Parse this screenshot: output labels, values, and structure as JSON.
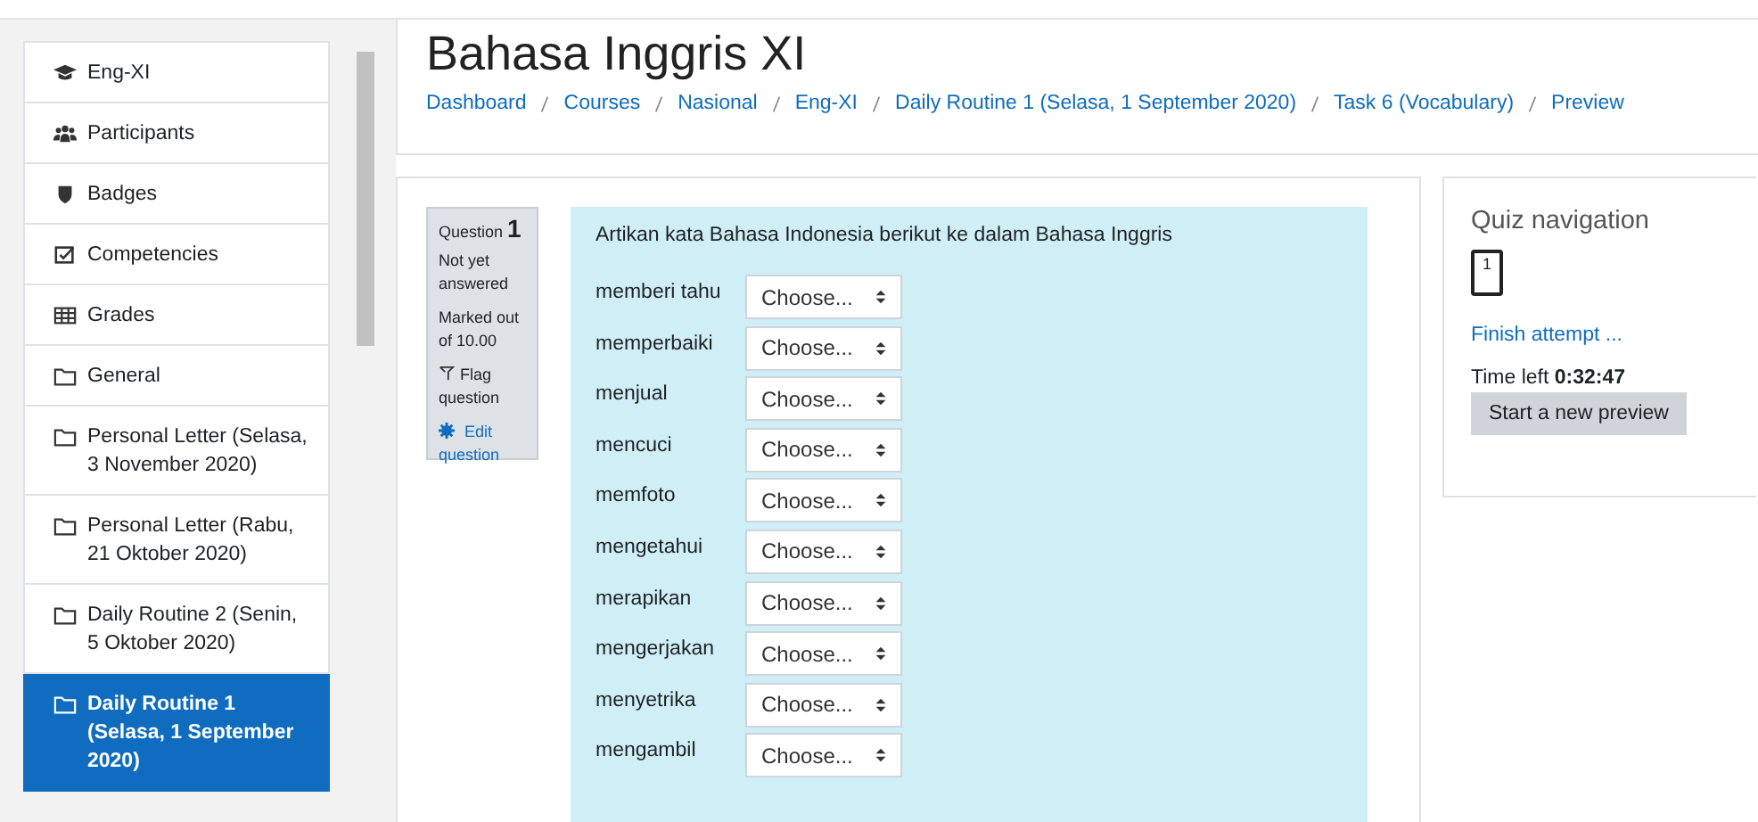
{
  "sidebar": {
    "items": [
      {
        "label": "Eng-XI",
        "kind": "cap",
        "selected": false
      },
      {
        "label": "Participants",
        "kind": "people",
        "selected": false
      },
      {
        "label": "Badges",
        "kind": "shield",
        "selected": false
      },
      {
        "label": "Competencies",
        "kind": "checkbox",
        "selected": false
      },
      {
        "label": "Grades",
        "kind": "grid",
        "selected": false
      },
      {
        "label": "General",
        "kind": "folder",
        "selected": false
      },
      {
        "label": "Personal Letter (Selasa, 3 November 2020)",
        "kind": "folder",
        "selected": false
      },
      {
        "label": "Personal Letter (Rabu, 21 Oktober 2020)",
        "kind": "folder",
        "selected": false
      },
      {
        "label": "Daily Routine 2 (Senin, 5 Oktober 2020)",
        "kind": "folder",
        "selected": false
      },
      {
        "label": "Daily Routine 1 (Selasa, 1 September 2020)",
        "kind": "folder",
        "selected": true
      }
    ]
  },
  "page_title": "Bahasa Inggris XI",
  "breadcrumbs": [
    "Dashboard",
    "Courses",
    "Nasional",
    "Eng-XI",
    "Daily Routine 1 (Selasa, 1 September 2020)",
    "Task 6 (Vocabulary)",
    "Preview"
  ],
  "question_info": {
    "number": "Question **1**",
    "status": "Not yet answered",
    "marks": "Marked out of 10.00",
    "flag": "Flag question",
    "edit": "Edit question"
  },
  "question": {
    "prompt": "Artikan kata Bahasa Indonesia berikut ke dalam Bahasa Inggris",
    "rows": [
      {
        "word": "memberi tahu",
        "value": "Choose..."
      },
      {
        "word": "memperbaiki",
        "value": "Choose..."
      },
      {
        "word": "menjual",
        "value": "Choose..."
      },
      {
        "word": "mencuci",
        "value": "Choose..."
      },
      {
        "word": "memfoto",
        "value": "Choose..."
      },
      {
        "word": "mengetahui",
        "value": "Choose..."
      },
      {
        "word": "merapikan",
        "value": "Choose..."
      },
      {
        "word": "mengerjakan",
        "value": "Choose..."
      },
      {
        "word": "menyetrika",
        "value": "Choose..."
      },
      {
        "word": "mengambil",
        "value": "Choose..."
      }
    ]
  },
  "quiz_navigation": {
    "title": "Quiz navigation",
    "questions": [
      "1"
    ],
    "finish": "Finish attempt ...",
    "time_left": "Time left **0:32:47**",
    "button": "Start a new preview"
  }
}
